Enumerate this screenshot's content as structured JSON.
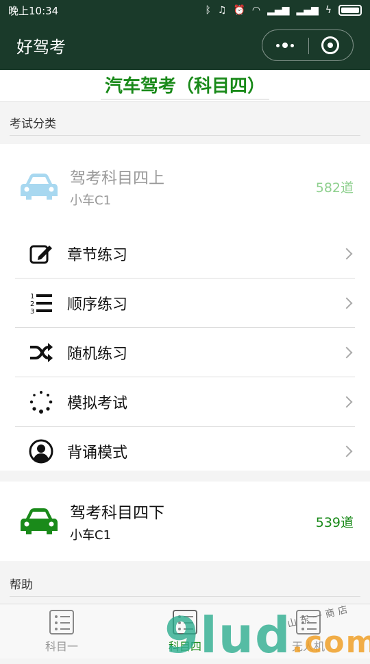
{
  "status_bar": {
    "time": "晚上10:34"
  },
  "nav": {
    "title": "好驾考"
  },
  "page_title": "汽车驾考（科目四）",
  "sections": {
    "exam_category": "考试分类",
    "help": "帮助"
  },
  "subject_upper": {
    "name": "驾考科目四上",
    "vehicle": "小车C1",
    "count": "582道",
    "icon_color": "#a8d8f0"
  },
  "menu": [
    {
      "label": "章节练习",
      "icon": "edit-icon"
    },
    {
      "label": "顺序练习",
      "icon": "numbered-list-icon"
    },
    {
      "label": "随机练习",
      "icon": "shuffle-icon"
    },
    {
      "label": "模拟考试",
      "icon": "loading-dots-icon"
    },
    {
      "label": "背诵模式",
      "icon": "user-circle-icon"
    }
  ],
  "subject_lower": {
    "name": "驾考科目四下",
    "vehicle": "小车C1",
    "count": "539道",
    "icon_color": "#1a8a1a"
  },
  "tabs": [
    {
      "label": "科目一"
    },
    {
      "label": "科目四"
    },
    {
      "label": "无人机"
    }
  ],
  "watermark": {
    "main": "9lud",
    "tld": ".com",
    "note": "山东一商店"
  },
  "colors": {
    "nav_bg": "#1a3a2a",
    "accent_green": "#1a8a1a"
  }
}
